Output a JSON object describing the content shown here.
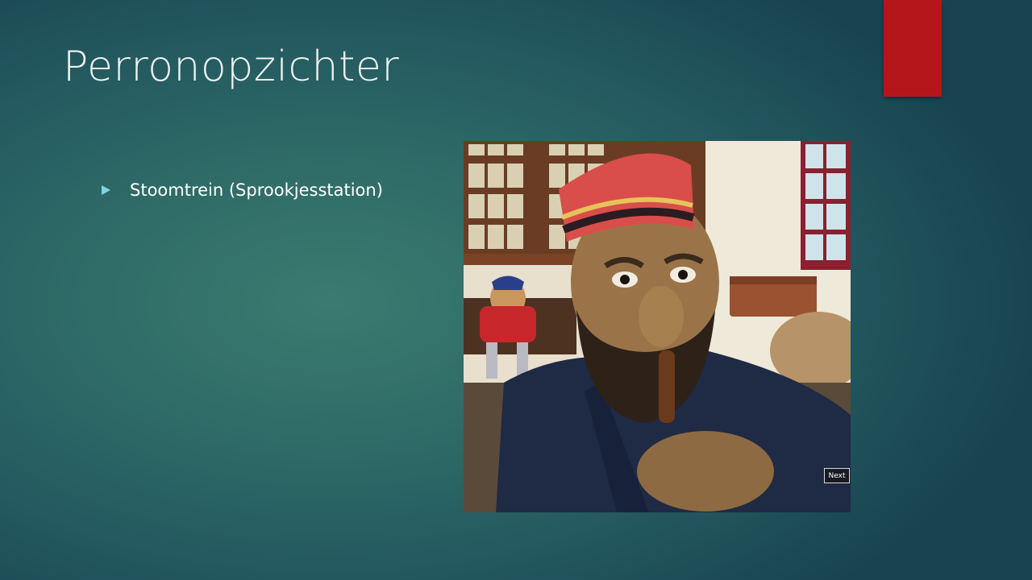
{
  "slide": {
    "title": "Perronopzichter",
    "bullets": [
      {
        "text": "Stoomtrein (Sprookjesstation)"
      }
    ],
    "accent_color": "#b5161b",
    "bullet_color": "#7fd3e0"
  },
  "photo": {
    "next_label": "Next"
  }
}
